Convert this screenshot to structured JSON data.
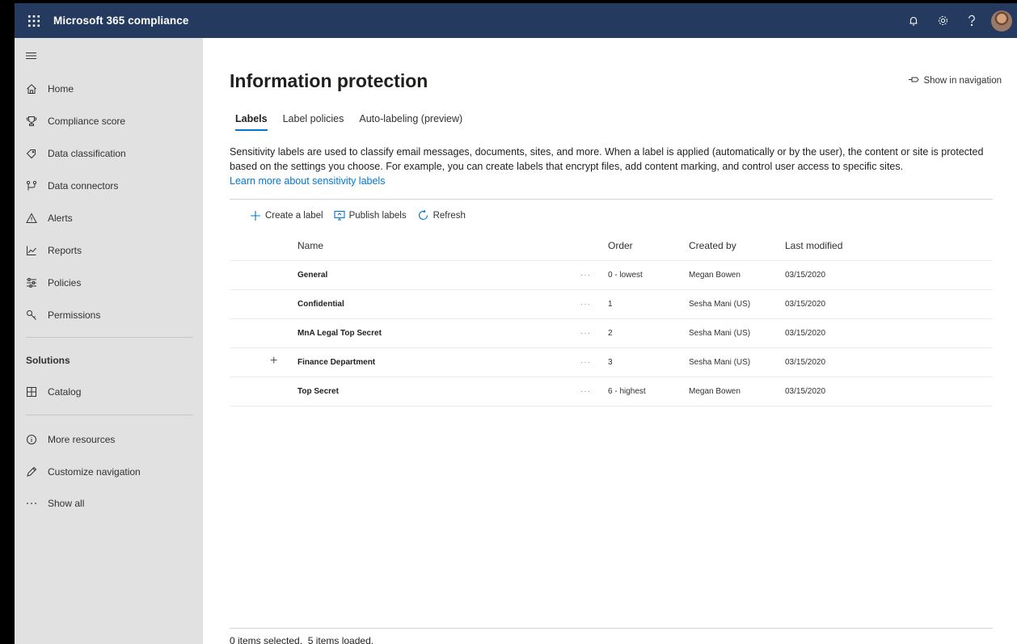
{
  "app": {
    "title": "Microsoft 365 compliance"
  },
  "topbar": {
    "icons": [
      "waffle-icon",
      "bell-icon",
      "gear-icon",
      "help-icon",
      "avatar"
    ]
  },
  "sidebar": {
    "items": [
      {
        "label": "Home",
        "icon": "home-icon"
      },
      {
        "label": "Compliance score",
        "icon": "trophy-icon"
      },
      {
        "label": "Data classification",
        "icon": "tag-icon"
      },
      {
        "label": "Data connectors",
        "icon": "connector-icon"
      },
      {
        "label": "Alerts",
        "icon": "warning-icon"
      },
      {
        "label": "Reports",
        "icon": "chart-icon"
      },
      {
        "label": "Policies",
        "icon": "sliders-icon"
      },
      {
        "label": "Permissions",
        "icon": "key-icon"
      }
    ],
    "solutions_heading": "Solutions",
    "solutions": [
      {
        "label": "Catalog",
        "icon": "catalog-icon"
      }
    ],
    "extra": [
      {
        "label": "More resources",
        "icon": "info-icon"
      },
      {
        "label": "Customize navigation",
        "icon": "pencil-icon"
      },
      {
        "label": "Show all",
        "icon": "ellipsis-icon"
      }
    ]
  },
  "main": {
    "title": "Information protection",
    "show_in_navigation": "Show in navigation",
    "tabs": [
      {
        "label": "Labels",
        "active": true
      },
      {
        "label": "Label policies",
        "active": false
      },
      {
        "label": "Auto-labeling (preview)",
        "active": false
      }
    ],
    "description": "Sensitivity labels are used to classify email messages, documents, sites, and more. When a label is applied (automatically or by the user), the content or site is protected based on the settings you choose. For example, you can create labels that encrypt files, add content marking, and control user access to specific sites.",
    "learn_more": "Learn more about sensitivity labels",
    "commands": {
      "create": "Create a label",
      "publish": "Publish labels",
      "refresh": "Refresh"
    },
    "table": {
      "columns": {
        "name": "Name",
        "order": "Order",
        "created_by": "Created by",
        "last_modified": "Last modified"
      },
      "rows": [
        {
          "name": "General",
          "more": "···",
          "order": "0 - lowest",
          "created_by": "Megan Bowen",
          "last_modified": "03/15/2020"
        },
        {
          "name": "Confidential",
          "more": "···",
          "order": "1",
          "created_by": "Sesha Mani (US)",
          "last_modified": "03/15/2020"
        },
        {
          "name": "MnA Legal Top Secret",
          "more": "···",
          "order": "2",
          "created_by": "Sesha Mani (US)",
          "last_modified": "03/15/2020"
        },
        {
          "name": "Finance Department",
          "more": "···",
          "order": "3",
          "created_by": "Sesha Mani (US)",
          "last_modified": "03/15/2020",
          "expand": "+"
        },
        {
          "name": "Top Secret",
          "more": "···",
          "order": "6 - highest",
          "created_by": "Megan Bowen",
          "last_modified": "03/15/2020"
        }
      ]
    },
    "status": "0 items selected.  5 items loaded."
  },
  "colors": {
    "topbar": "#243a5e",
    "sidebar": "#e1e1e1",
    "accent": "#0078d4"
  }
}
